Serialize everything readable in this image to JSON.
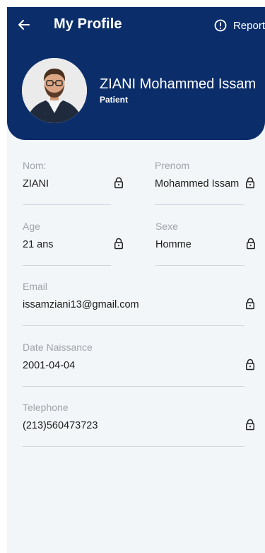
{
  "header": {
    "title": "My Profile",
    "report_label": "Report",
    "name": "ZIANI Mohammed Issam",
    "role": "Patient",
    "background_color": "#0b2e6b"
  },
  "icons": {
    "back": "arrow-left-icon",
    "report": "exclamation-circle-icon",
    "lock": "lock-icon"
  },
  "fields": {
    "nom": {
      "label": "Nom:",
      "value": "ZIANI"
    },
    "prenom": {
      "label": "Prenom",
      "value": "Mohammed Issam"
    },
    "age": {
      "label": "Age",
      "value": "21 ans"
    },
    "sexe": {
      "label": "Sexe",
      "value": "Homme"
    },
    "email": {
      "label": "Email",
      "value": "issamziani13@gmail.com"
    },
    "date_naissance": {
      "label": "Date Naissance",
      "value": "2001-04-04"
    },
    "telephone": {
      "label": "Telephone",
      "value": "(213)560473723"
    }
  }
}
